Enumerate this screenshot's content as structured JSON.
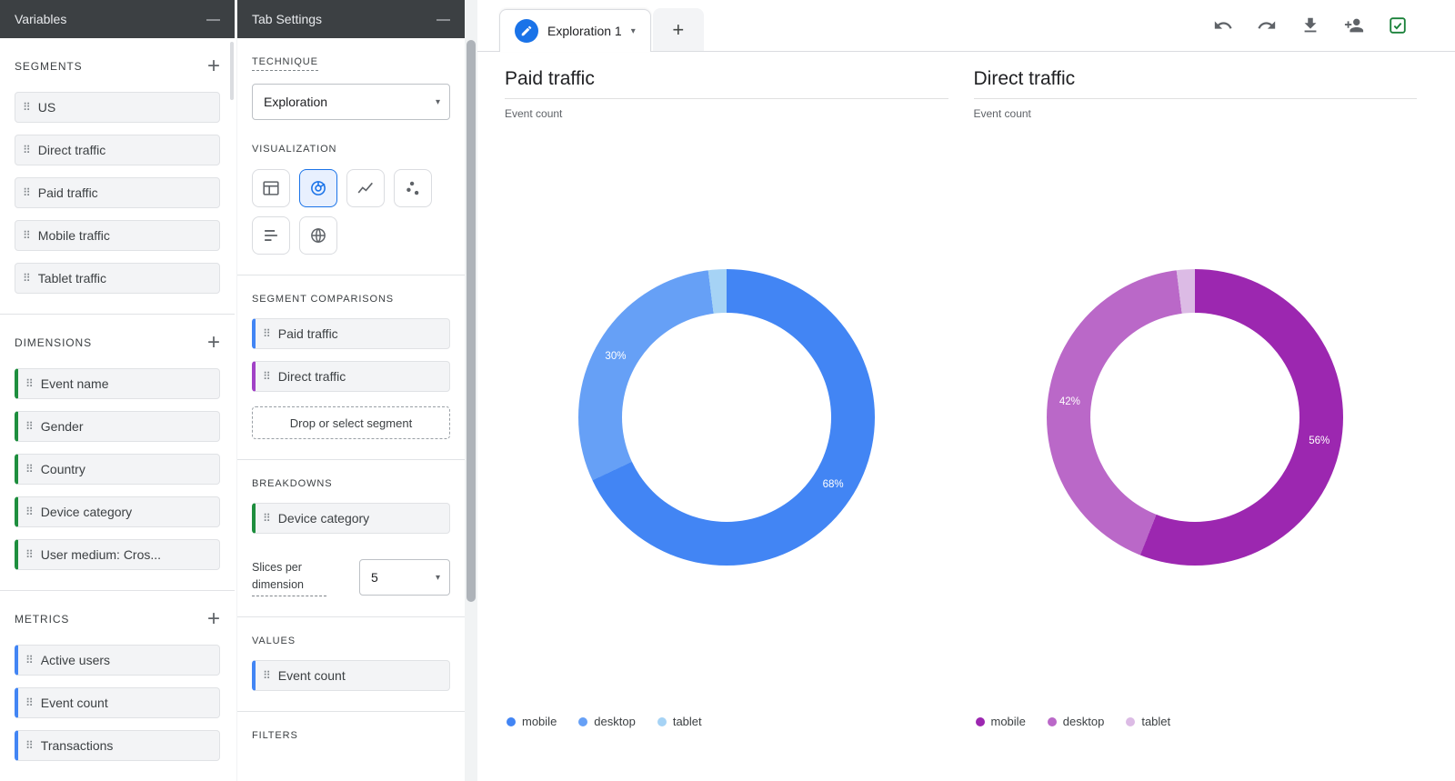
{
  "ui": {
    "minimize_glyph": "—",
    "add_glyph": "+",
    "caret_glyph": "▾",
    "drag_glyph": "⠿"
  },
  "colors": {
    "panel_header_bg": "#3c4043",
    "dimension_accent": "#1e8e3e",
    "metric_accent": "#4285f4",
    "segment_blue_accent": "#4285f4",
    "segment_purple_accent": "#a142c6",
    "selected_viz": "#1a73e8",
    "export_icon_green": "#188038"
  },
  "variables_panel": {
    "title": "Variables",
    "segments": {
      "title": "SEGMENTS",
      "items": [
        {
          "label": "US"
        },
        {
          "label": "Direct traffic"
        },
        {
          "label": "Paid traffic"
        },
        {
          "label": "Mobile traffic"
        },
        {
          "label": "Tablet traffic"
        }
      ]
    },
    "dimensions": {
      "title": "DIMENSIONS",
      "items": [
        {
          "label": "Event name",
          "accent": "#1e8e3e"
        },
        {
          "label": "Gender",
          "accent": "#1e8e3e"
        },
        {
          "label": "Country",
          "accent": "#1e8e3e"
        },
        {
          "label": "Device category",
          "accent": "#1e8e3e"
        },
        {
          "label": "User medium: Cros...",
          "accent": "#1e8e3e"
        }
      ]
    },
    "metrics": {
      "title": "METRICS",
      "items": [
        {
          "label": "Active users",
          "accent": "#4285f4"
        },
        {
          "label": "Event count",
          "accent": "#4285f4"
        },
        {
          "label": "Transactions",
          "accent": "#4285f4"
        }
      ]
    }
  },
  "tab_settings_panel": {
    "title": "Tab Settings",
    "technique_label": "TECHNIQUE",
    "technique_value": "Exploration",
    "visualization_label": "VISUALIZATION",
    "visualization_options": [
      "table",
      "donut-chart",
      "line-chart",
      "scatter-chart",
      "bar-chart",
      "geo-map"
    ],
    "visualization_selected": "donut-chart",
    "segment_comparisons_label": "SEGMENT COMPARISONS",
    "segment_comparisons_items": [
      {
        "label": "Paid traffic",
        "accent": "#4285f4"
      },
      {
        "label": "Direct traffic",
        "accent": "#a142c6"
      }
    ],
    "segment_drop_label": "Drop or select segment",
    "breakdowns_label": "BREAKDOWNS",
    "breakdowns_items": [
      {
        "label": "Device category",
        "accent": "#1e8e3e"
      }
    ],
    "slices_label": "Slices per dimension",
    "slices_value": "5",
    "values_label": "VALUES",
    "values_items": [
      {
        "label": "Event count",
        "accent": "#4285f4"
      }
    ],
    "filters_label": "FILTERS"
  },
  "canvas": {
    "tab_name": "Exploration 1",
    "toolbar_icons": [
      "undo",
      "redo",
      "download",
      "share-add-users",
      "fact-check"
    ]
  },
  "chart_data": [
    {
      "type": "pie",
      "donut": true,
      "title": "Paid traffic",
      "subtitle": "Event count",
      "categories": [
        "mobile",
        "desktop",
        "tablet"
      ],
      "values": [
        68,
        30,
        2
      ],
      "colors": [
        "#4285f4",
        "#66a0f6",
        "#a6d3f5"
      ],
      "labels": [
        "68%",
        "30%"
      ],
      "legend_position": "bottom"
    },
    {
      "type": "pie",
      "donut": true,
      "title": "Direct traffic",
      "subtitle": "Event count",
      "categories": [
        "mobile",
        "desktop",
        "tablet"
      ],
      "values": [
        56,
        42,
        2
      ],
      "colors": [
        "#9c27b0",
        "#ba68c8",
        "#dcbbe5"
      ],
      "labels": [
        "56%",
        "42%"
      ],
      "legend_position": "bottom"
    }
  ]
}
